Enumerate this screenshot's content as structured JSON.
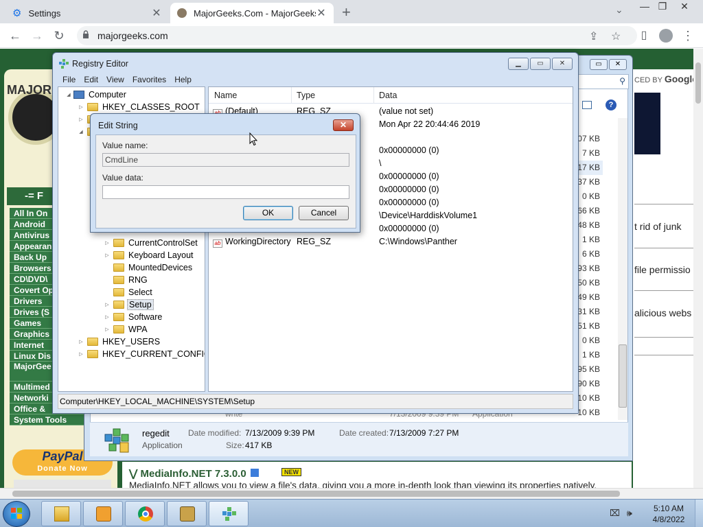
{
  "browser": {
    "tabs": [
      {
        "title": "Settings",
        "icon": "gear-icon",
        "active": false
      },
      {
        "title": "MajorGeeks.Com - MajorGeeks",
        "icon": "majorgeeks-favicon",
        "active": true
      }
    ],
    "new_tab": "+",
    "url": "majorgeeks.com",
    "window_controls": {
      "minimize": "—",
      "restore": "❐",
      "close": "✕"
    }
  },
  "website": {
    "logo_text": "MAJOR",
    "sidebar_header": "-= F",
    "sidebar_items": [
      "All In On",
      "Android",
      "Antivirus",
      "Appearan",
      "Back Up",
      "Browsers",
      "CD\\DVD\\",
      "Covert Op",
      "Drivers",
      "Drives (S",
      "Games",
      "Graphics",
      "Internet",
      "Linux Dis",
      "MajorGee Tweaks",
      "Multimed",
      "Networki",
      "Office & ",
      "System Tools"
    ],
    "paypal_logo": "PayPal",
    "paypal_donate": "Donate Now",
    "google_text_prefix": "CED BY",
    "google_brand": "Google",
    "right_snippets": [
      "t rid of junk",
      "file permissio",
      "alicious webs"
    ],
    "article_title": "MediaInfo.NET 7.3.0.0",
    "new_badge": "NEW",
    "article_text": "MediaInfo.NET allows you to view a file's data, giving you a more in-depth look than viewing its properties natively."
  },
  "explorer": {
    "sizes": [
      "07 KB",
      "7 KB",
      "17 KB",
      "37 KB",
      "0 KB",
      "66 KB",
      "48 KB",
      "1 KB",
      "6 KB",
      "93 KB",
      "50 KB",
      "49 KB",
      "31 KB",
      "51 KB",
      "0 KB",
      "1 KB",
      "95 KB",
      "90 KB",
      "10 KB",
      "10 KB"
    ],
    "faded_row": {
      "name": "write",
      "date": "7/13/2009 9:39 PM",
      "type": "Application"
    },
    "details": {
      "name": "regedit",
      "type": "Application",
      "date_modified_label": "Date modified:",
      "date_modified": "7/13/2009 9:39 PM",
      "date_created_label": "Date created:",
      "date_created": "7/13/2009 7:27 PM",
      "size_label": "Size:",
      "size": "417 KB"
    }
  },
  "regedit": {
    "title": "Registry Editor",
    "menu": [
      "File",
      "Edit",
      "View",
      "Favorites",
      "Help"
    ],
    "tree": {
      "computer": "Computer",
      "classes_root": "HKEY_CLASSES_ROOT",
      "system_children": [
        "CurrentControlSet",
        "Keyboard Layout",
        "MountedDevices",
        "RNG",
        "Select",
        "Setup",
        "Software",
        "WPA"
      ],
      "users": "HKEY_USERS",
      "current_config": "HKEY_CURRENT_CONFIG"
    },
    "columns": {
      "name": "Name",
      "type": "Type",
      "data": "Data"
    },
    "rows": [
      {
        "name": "(Default)",
        "type": "REG_SZ",
        "data": "(value not set)"
      },
      {
        "name": "",
        "type": "",
        "data": "Mon Apr 22 20:44:46 2019"
      },
      {
        "name": "",
        "type": "",
        "data": ""
      },
      {
        "name": "",
        "type": "",
        "data": "0x00000000 (0)"
      },
      {
        "name": "",
        "type": "",
        "data": "\\"
      },
      {
        "name": "",
        "type": "",
        "data": "0x00000000 (0)"
      },
      {
        "name": "",
        "type": "",
        "data": "0x00000000 (0)"
      },
      {
        "name": "",
        "type": "",
        "data": "0x00000000 (0)"
      },
      {
        "name": "",
        "type": "",
        "data": "\\Device\\HarddiskVolume1"
      },
      {
        "name": "",
        "type": "",
        "data": "0x00000000 (0)"
      },
      {
        "name": "WorkingDirectory",
        "type": "REG_SZ",
        "data": "C:\\Windows\\Panther"
      }
    ],
    "status": "Computer\\HKEY_LOCAL_MACHINE\\SYSTEM\\Setup"
  },
  "dialog": {
    "title": "Edit String",
    "value_name_label": "Value name:",
    "value_name": "CmdLine",
    "value_data_label": "Value data:",
    "value_data": "",
    "ok": "OK",
    "cancel": "Cancel",
    "close": "✕"
  },
  "taskbar": {
    "items": [
      "file-explorer-icon",
      "media-player-icon",
      "chrome-icon",
      "lock-app-icon",
      "regedit-icon"
    ],
    "time": "5:10 AM",
    "date": "4/8/2022"
  },
  "colors": {
    "site_green": "#256033",
    "sidebar_green": "#337a45",
    "aero_blue": "#d4e2f4",
    "close_red": "#c4432b"
  }
}
